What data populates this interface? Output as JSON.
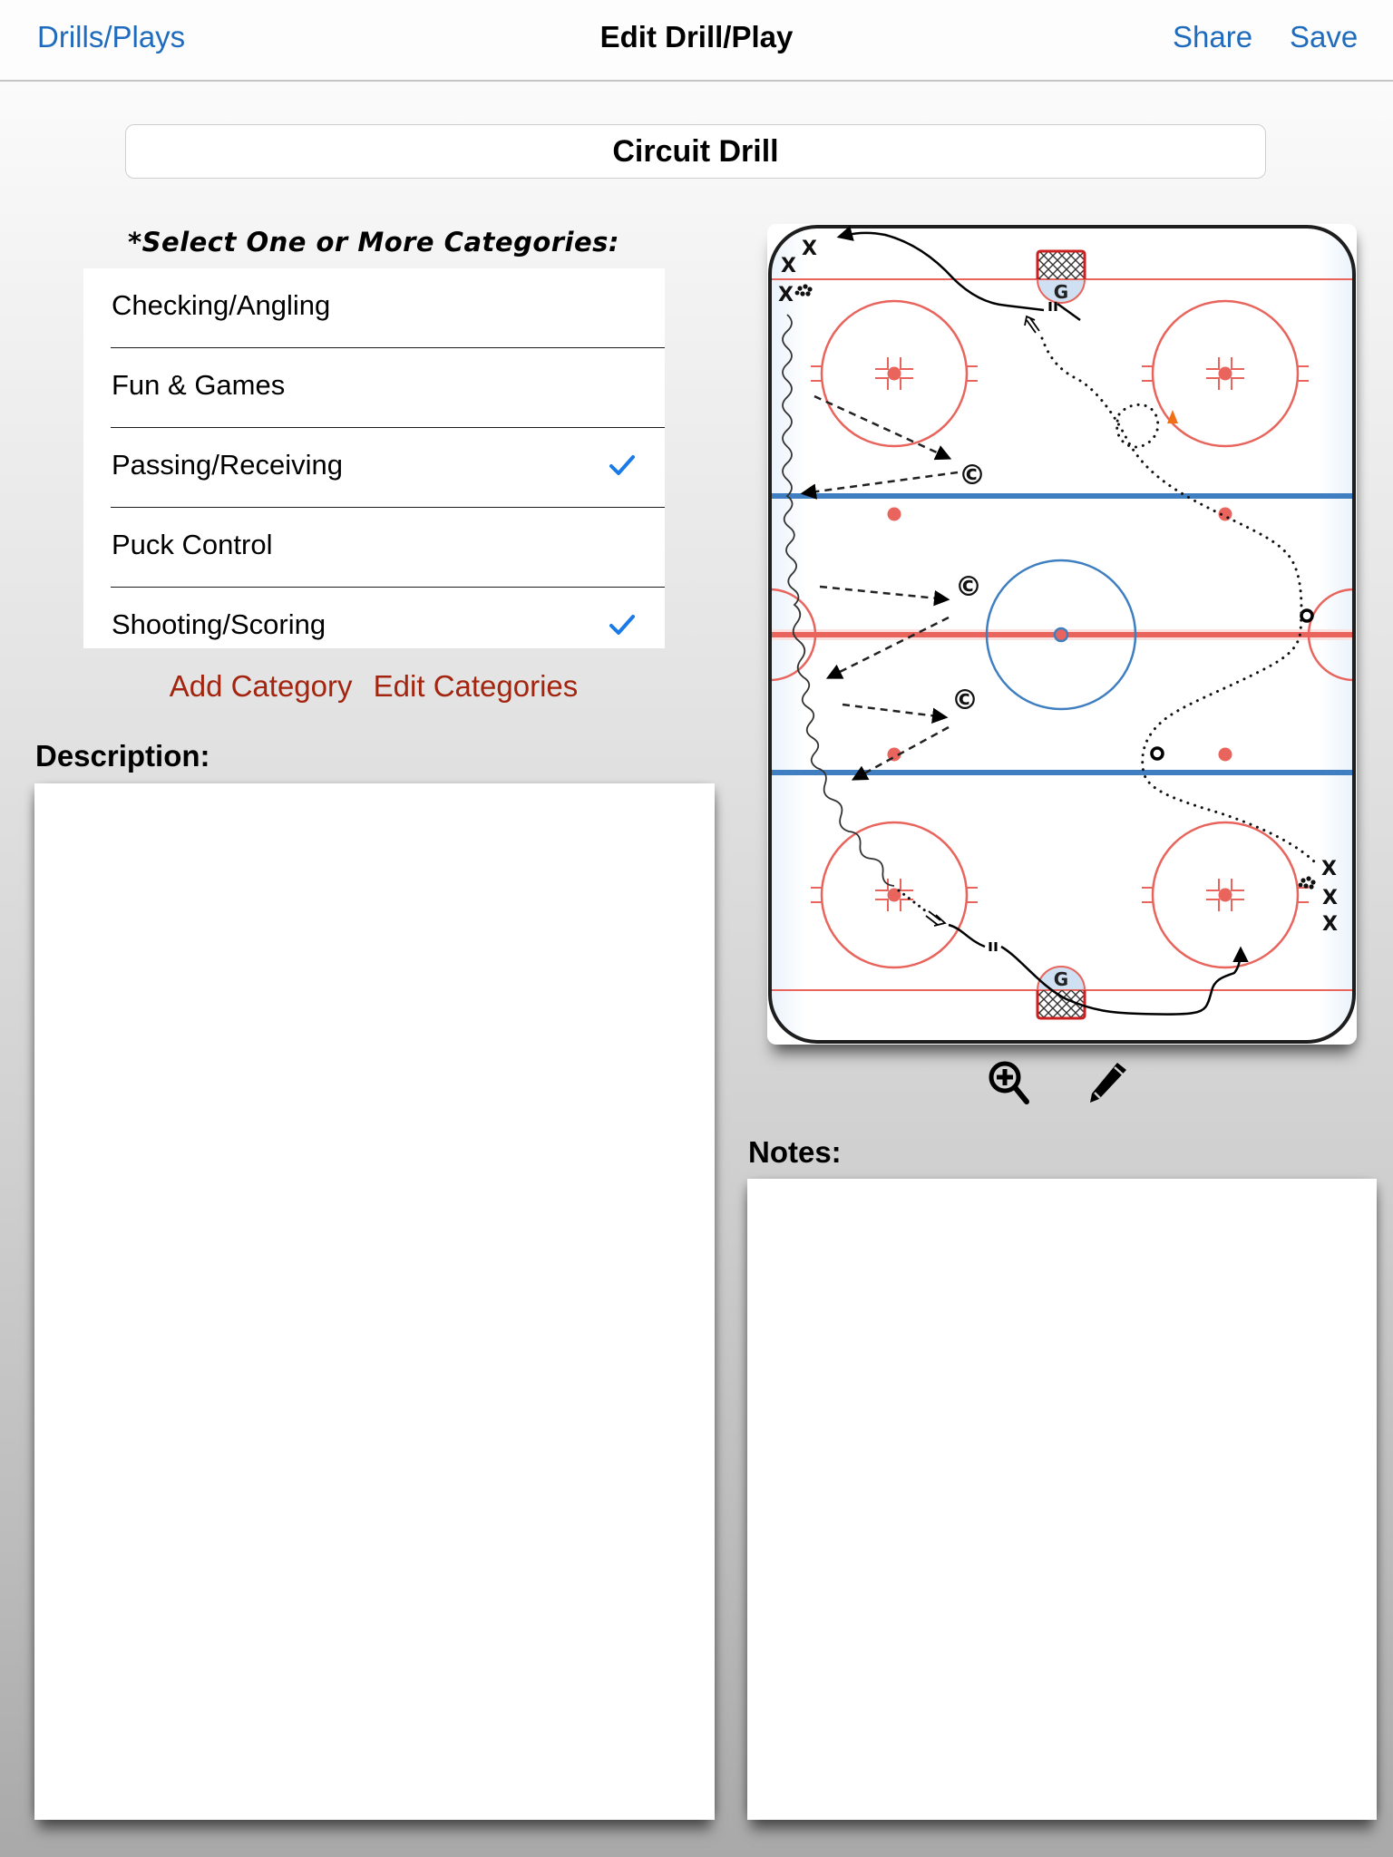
{
  "nav": {
    "back_label": "Drills/Plays",
    "title": "Edit Drill/Play",
    "share_label": "Share",
    "save_label": "Save"
  },
  "drill": {
    "name": "Circuit Drill",
    "name_placeholder": ""
  },
  "categories": {
    "heading": "*Select One or More Categories:",
    "items": [
      {
        "label": "Checking/Angling",
        "selected": false
      },
      {
        "label": "Fun & Games",
        "selected": false
      },
      {
        "label": "Passing/Receiving",
        "selected": true
      },
      {
        "label": "Puck Control",
        "selected": false
      },
      {
        "label": "Shooting/Scoring",
        "selected": true
      }
    ],
    "add_label": "Add Category",
    "edit_label": "Edit Categories"
  },
  "description": {
    "label": "Description:",
    "value": ""
  },
  "notes": {
    "label": "Notes:",
    "value": ""
  },
  "diagram": {
    "player_symbol": "X",
    "goalie_symbol": "G",
    "coach_symbol": "©",
    "top_goalie": "G",
    "bottom_goalie": "G",
    "legend": {
      "skating_path": "solid line with arrow",
      "pass": "dashed line with arrow",
      "skating_with_puck": "wavy line",
      "backward_skating": "dotted line",
      "stop": "double bar",
      "shot": "double-line arrow",
      "pylon": "orange triangle",
      "pucks": "cluster of dots"
    }
  },
  "toolbar": {
    "zoom_icon": "zoom-in-icon",
    "edit_icon": "pencil-icon"
  },
  "colors": {
    "link_blue": "#1f6bbd",
    "category_action_red": "#a3250f",
    "check_blue": "#1a7ae8",
    "rink_red": "#e8645c",
    "rink_blue": "#3f7fc1",
    "crease_fill": "#cfe0f2",
    "pylon_orange": "#f07018"
  }
}
